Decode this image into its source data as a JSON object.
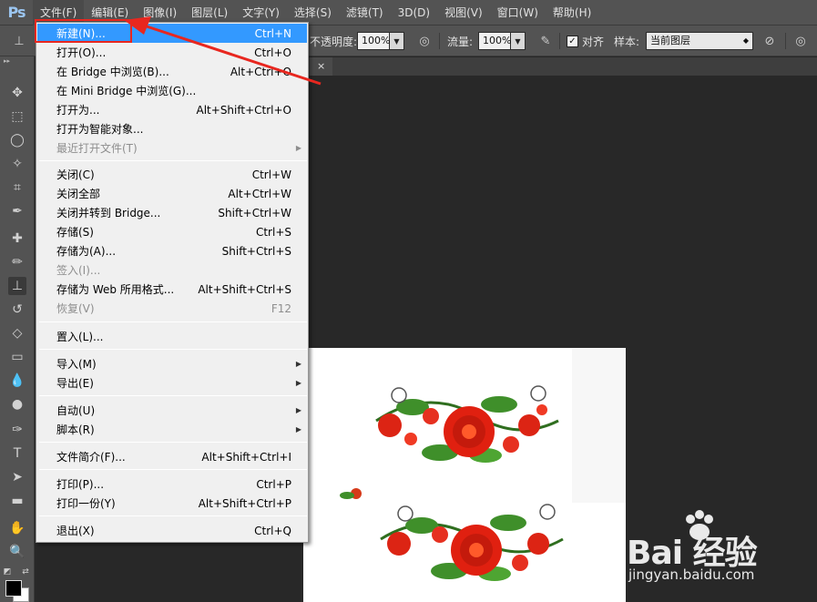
{
  "app": {
    "logo": "Ps"
  },
  "menubar": {
    "items": [
      "文件(F)",
      "编辑(E)",
      "图像(I)",
      "图层(L)",
      "文字(Y)",
      "选择(S)",
      "滤镜(T)",
      "3D(D)",
      "视图(V)",
      "窗口(W)",
      "帮助(H)"
    ]
  },
  "options": {
    "opacity_label": "不透明度:",
    "opacity_value": "100%",
    "flow_label": "流量:",
    "flow_value": "100%",
    "align_label": "对齐",
    "align_checked": true,
    "sample_label": "样本:",
    "sample_value": "当前图层"
  },
  "tab": {
    "close": "×"
  },
  "file_menu": {
    "items": [
      {
        "label": "新建(N)...",
        "shortcut": "Ctrl+N",
        "highlight": true
      },
      {
        "label": "打开(O)...",
        "shortcut": "Ctrl+O"
      },
      {
        "label": "在 Bridge 中浏览(B)...",
        "shortcut": "Alt+Ctrl+O"
      },
      {
        "label": "在 Mini Bridge 中浏览(G)...",
        "shortcut": ""
      },
      {
        "label": "打开为...",
        "shortcut": "Alt+Shift+Ctrl+O"
      },
      {
        "label": "打开为智能对象...",
        "shortcut": ""
      },
      {
        "label": "最近打开文件(T)",
        "shortcut": "",
        "submenu": true,
        "disabled": true
      },
      {
        "label": "关闭(C)",
        "shortcut": "Ctrl+W"
      },
      {
        "label": "关闭全部",
        "shortcut": "Alt+Ctrl+W"
      },
      {
        "label": "关闭并转到 Bridge...",
        "shortcut": "Shift+Ctrl+W"
      },
      {
        "label": "存储(S)",
        "shortcut": "Ctrl+S"
      },
      {
        "label": "存储为(A)...",
        "shortcut": "Shift+Ctrl+S"
      },
      {
        "label": "签入(I)...",
        "shortcut": "",
        "disabled": true
      },
      {
        "label": "存储为 Web 所用格式...",
        "shortcut": "Alt+Shift+Ctrl+S"
      },
      {
        "label": "恢复(V)",
        "shortcut": "F12",
        "disabled": true
      },
      {
        "label": "置入(L)...",
        "shortcut": ""
      },
      {
        "label": "导入(M)",
        "shortcut": "",
        "submenu": true
      },
      {
        "label": "导出(E)",
        "shortcut": "",
        "submenu": true
      },
      {
        "label": "自动(U)",
        "shortcut": "",
        "submenu": true
      },
      {
        "label": "脚本(R)",
        "shortcut": "",
        "submenu": true
      },
      {
        "label": "文件简介(F)...",
        "shortcut": "Alt+Shift+Ctrl+I"
      },
      {
        "label": "打印(P)...",
        "shortcut": "Ctrl+P"
      },
      {
        "label": "打印一份(Y)",
        "shortcut": "Alt+Shift+Ctrl+P"
      },
      {
        "label": "退出(X)",
        "shortcut": "Ctrl+Q"
      }
    ]
  },
  "watermark": {
    "brand": "Bai 经验",
    "url": "jingyan.baidu.com"
  },
  "colors": {
    "highlight": "#3399ff",
    "annotation_red": "#e8271f",
    "ui_gray": "#535353",
    "workspace": "#282828"
  }
}
